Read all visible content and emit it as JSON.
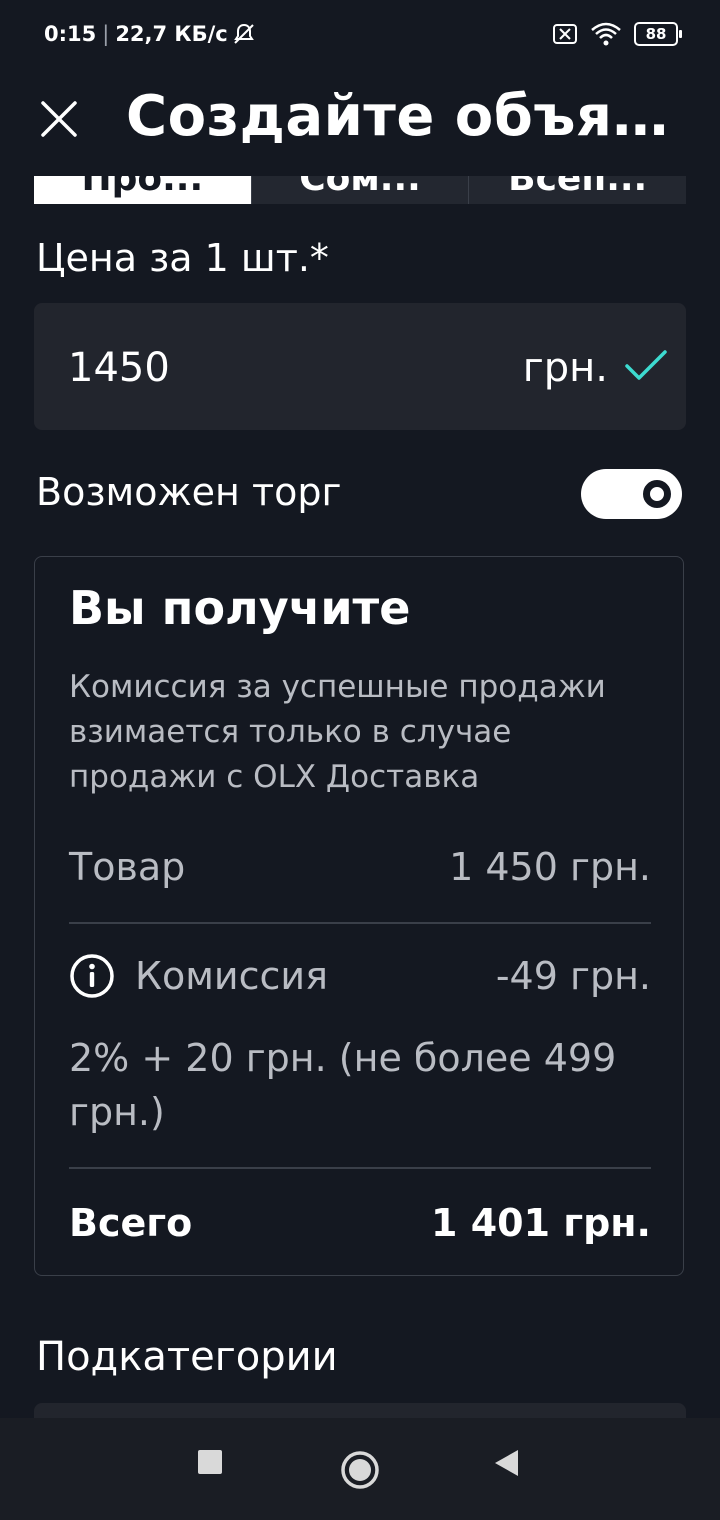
{
  "status_bar": {
    "time": "0:15",
    "network_speed": "22,7 КБ/с",
    "battery_level": "88",
    "icons": [
      "mute-alarm-icon",
      "sim-off-icon",
      "wifi-icon",
      "battery-icon"
    ]
  },
  "header": {
    "title": "Создайте объявление",
    "close_icon": "close-icon"
  },
  "segments": {
    "items": [
      {
        "label": "Про..."
      },
      {
        "label": "Сом..."
      },
      {
        "label": "Всеп..."
      }
    ],
    "active_index": 0
  },
  "price": {
    "label": "Цена за 1 шт.*",
    "value": "1450",
    "currency": "грн.",
    "valid_icon": "check-icon",
    "accent_color": "#3ddbd0"
  },
  "bargain": {
    "label": "Возможен торг",
    "enabled": true
  },
  "receive_card": {
    "title": "Вы получите",
    "description": "Комиссия за успешные продажи взимается только в случае продажи с OLX Доставка",
    "goods_label": "Товар",
    "goods_value": "1 450 грн.",
    "commission_label": "Комиссия",
    "commission_value": "-49 грн.",
    "commission_formula": "2% + 20 грн. (не более 499 грн.)",
    "total_label": "Всего",
    "total_value": "1 401 грн."
  },
  "subcategories": {
    "label": "Подкатегории"
  },
  "colors": {
    "background": "#141821",
    "field": "#22252d",
    "muted_text": "#b9bcc3",
    "accent": "#3ddbd0"
  }
}
